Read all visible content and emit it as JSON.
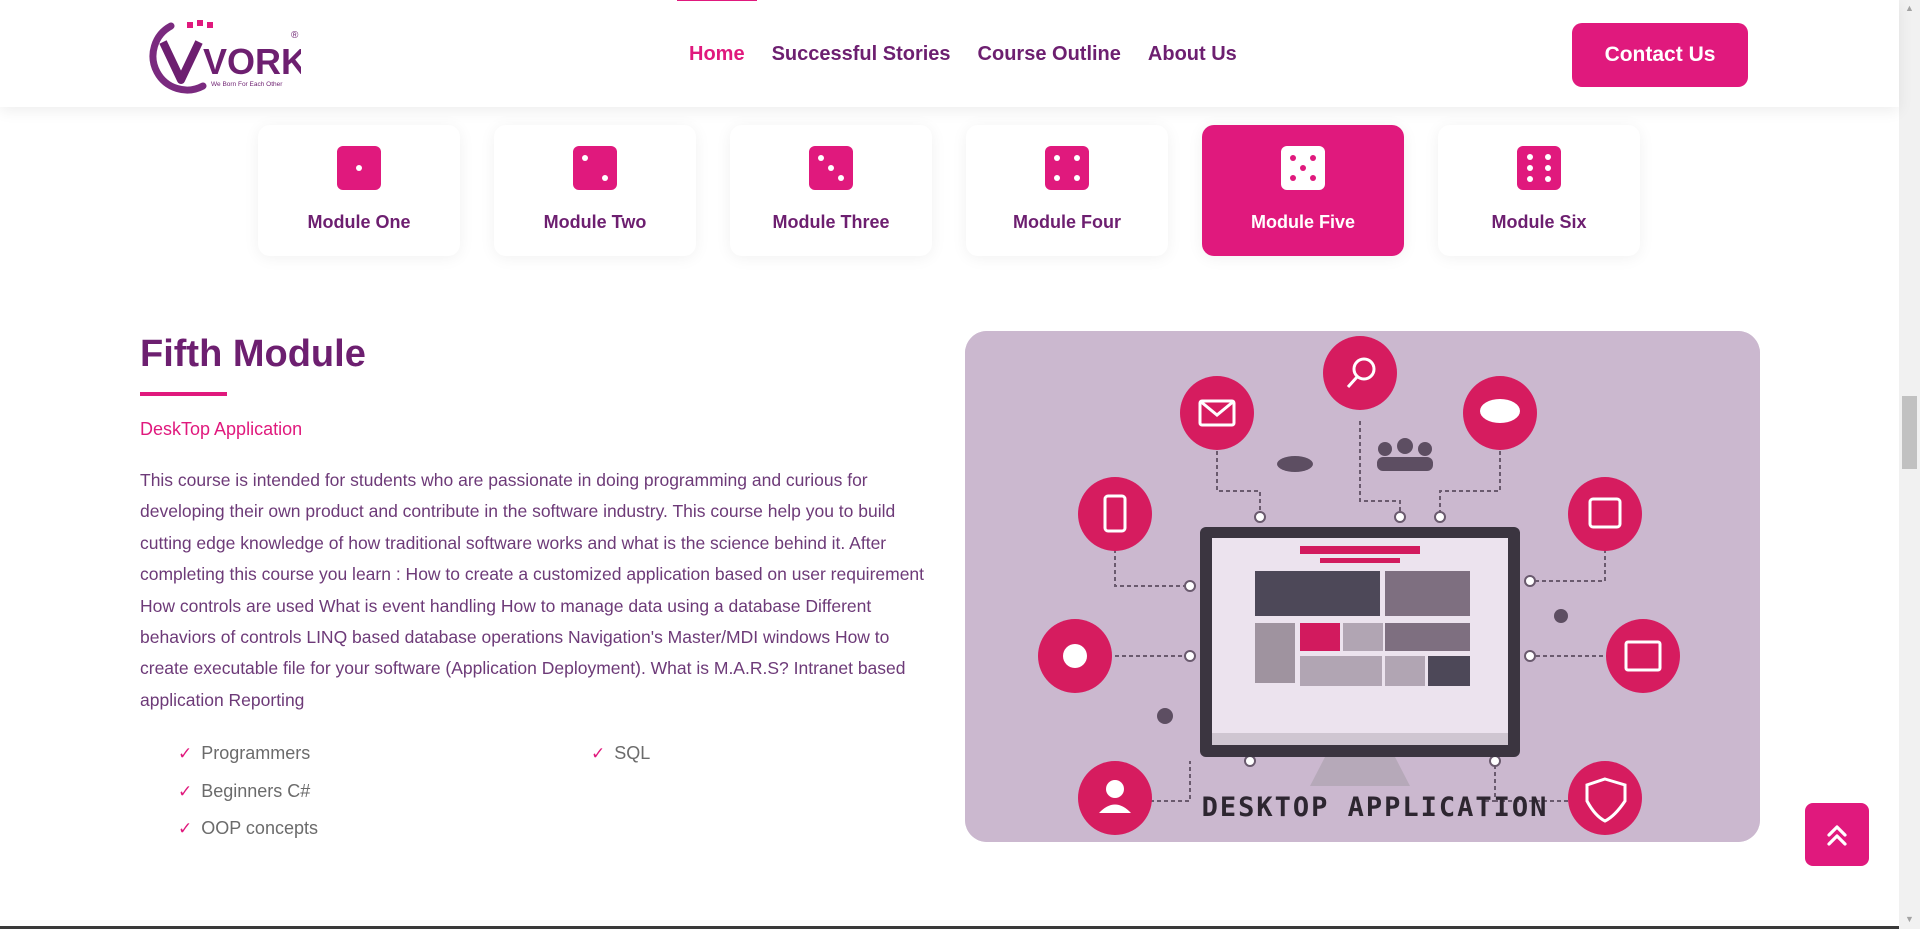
{
  "header": {
    "logo_text": "VORK",
    "logo_tagline": "We Born For Each Other",
    "logo_mark": "®",
    "nav": [
      {
        "label": "Home",
        "active": true
      },
      {
        "label": "Successful Stories",
        "active": false
      },
      {
        "label": "Course Outline",
        "active": false
      },
      {
        "label": "About Us",
        "active": false
      }
    ],
    "contact_label": "Contact Us"
  },
  "tabs": [
    {
      "label": "Module One",
      "icon": "dice-one-icon",
      "active": false
    },
    {
      "label": "Module Two",
      "icon": "dice-two-icon",
      "active": false
    },
    {
      "label": "Module Three",
      "icon": "dice-three-icon",
      "active": false
    },
    {
      "label": "Module Four",
      "icon": "dice-four-icon",
      "active": false
    },
    {
      "label": "Module Five",
      "icon": "dice-five-icon",
      "active": true
    },
    {
      "label": "Module Six",
      "icon": "dice-six-icon",
      "active": false
    }
  ],
  "module": {
    "title": "Fifth Module",
    "subtitle": "DeskTop Application",
    "description": "This course is intended for students who are passionate in doing programming and curious for developing their own product and contribute in the software industry. This course help you to build cutting edge knowledge of how traditional software works and what is the science behind it. After completing this course you learn : How to create a customized application based on user requirement How controls are used What is event handling How to manage data using a database Different behaviors of controls LINQ based database operations Navigation's Master/MDI windows How to create executable file for your software (Application Deployment). What is M.A.R.S? Intranet based application Reporting",
    "checklist": [
      "Programmers",
      "Beginners C#",
      "OOP concepts",
      "SQL"
    ],
    "image_caption": "DESKTOP APPLICATION"
  },
  "colors": {
    "accent": "#e0197d",
    "primary_text": "#6d1f70",
    "image_bg": "#cbb8cf"
  },
  "icons": {
    "check": "check-icon",
    "scroll_top": "double-chevron-up-icon"
  }
}
